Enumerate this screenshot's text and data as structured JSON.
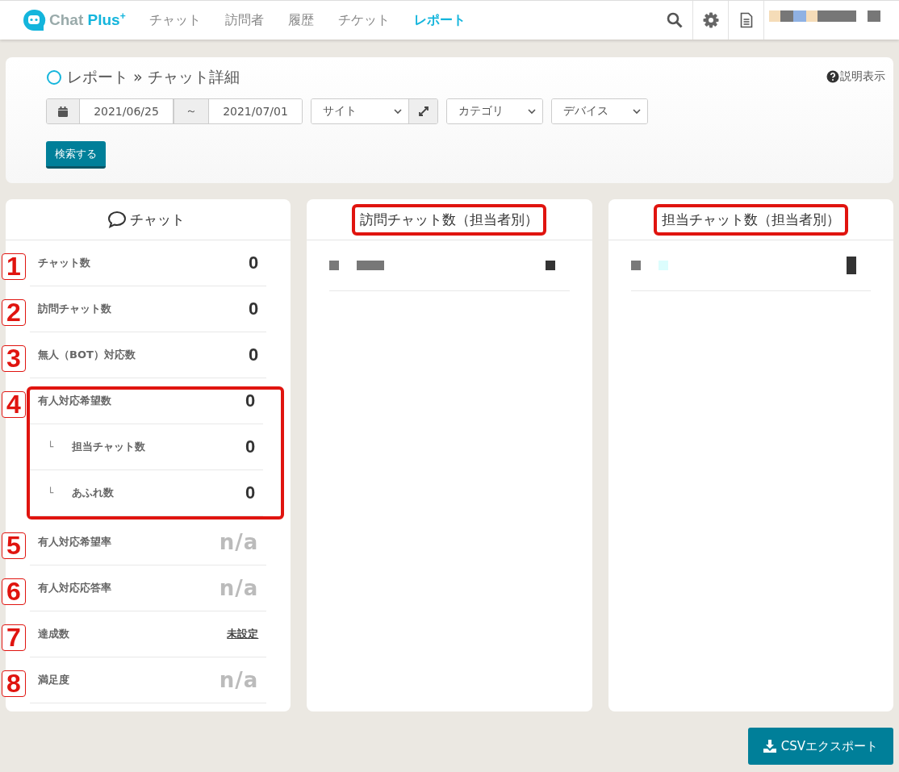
{
  "nav": {
    "logo": "Chat **Plus**$^{+}$",
    "items": [
      {
        "label": "チャット",
        "selected": false
      },
      {
        "label": "訪問者",
        "selected": false
      },
      {
        "label": "履歴",
        "selected": false
      },
      {
        "label": "チケット",
        "selected": false
      },
      {
        "label": "レポート",
        "selected": true
      }
    ]
  },
  "header": {
    "breadcrumb": "レポート » チャット詳細",
    "help": "説明表示",
    "date_from": "2021/06/25",
    "range_separator": "～",
    "date_to": "2021/07/01",
    "selects": [
      {
        "value": "サイト",
        "expand": true
      },
      {
        "value": "カテゴリ",
        "expand": false
      },
      {
        "value": "デバイス",
        "expand": false
      }
    ],
    "search_button": "検索する"
  },
  "chat_panel": {
    "title": "チャット",
    "rows": [
      {
        "marker": "1",
        "label": "チャット数",
        "value": "0",
        "kind": "count"
      },
      {
        "marker": "2",
        "label": "訪問チャット数",
        "value": "0",
        "kind": "count"
      },
      {
        "marker": "3",
        "label": "無人（BOT）対応数",
        "value": "0",
        "kind": "count"
      },
      {
        "marker": "4",
        "label": "有人対応希望数",
        "value": "0",
        "kind": "count",
        "highlighted": true,
        "children": [
          {
            "branch": "└",
            "label": "担当チャット数",
            "value": "0",
            "kind": "count"
          },
          {
            "branch": "└",
            "label": "あふれ数",
            "value": "0",
            "kind": "count"
          }
        ]
      },
      {
        "marker": "5",
        "label": "有人対応希望率",
        "value": "n/a",
        "kind": "na"
      },
      {
        "marker": "6",
        "label": "有人対応応答率",
        "value": "n/a",
        "kind": "na"
      },
      {
        "marker": "7",
        "label": "達成数",
        "value": "未設定",
        "kind": "link"
      },
      {
        "marker": "8",
        "label": "満足度",
        "value": "n/a",
        "kind": "na"
      }
    ]
  },
  "agent_panels": [
    {
      "title": "訪問チャット数（担当者別）",
      "highlighted": true
    },
    {
      "title": "担当チャット数（担当者別）",
      "highlighted": true
    }
  ],
  "export_button": "CSVエクスポート"
}
